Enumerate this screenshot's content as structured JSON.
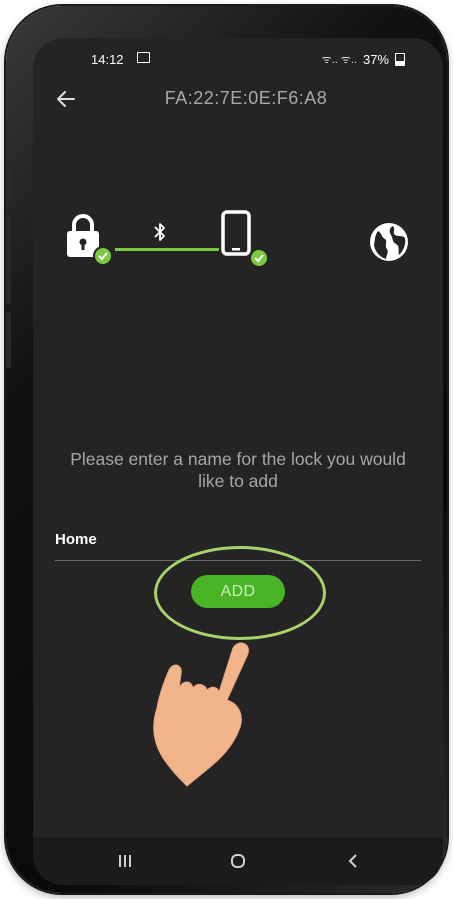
{
  "statusbar": {
    "time": "14:12",
    "signal_icons": "ᯤ.. ᯤ..",
    "battery": "37%"
  },
  "appbar": {
    "title": "FA:22:7E:0E:F6:A8"
  },
  "connection": {
    "lock_status": "connected",
    "phone_status": "connected",
    "link_icon": "bluetooth-icon",
    "cloud_icon": "globe-icon"
  },
  "form": {
    "prompt": "Please enter a name for the lock you would like to add",
    "name_value": "Home",
    "add_label": "ADD"
  },
  "colors": {
    "accent": "#49b425",
    "check": "#7ac943",
    "highlight": "#a8d26a",
    "background": "#242424"
  }
}
